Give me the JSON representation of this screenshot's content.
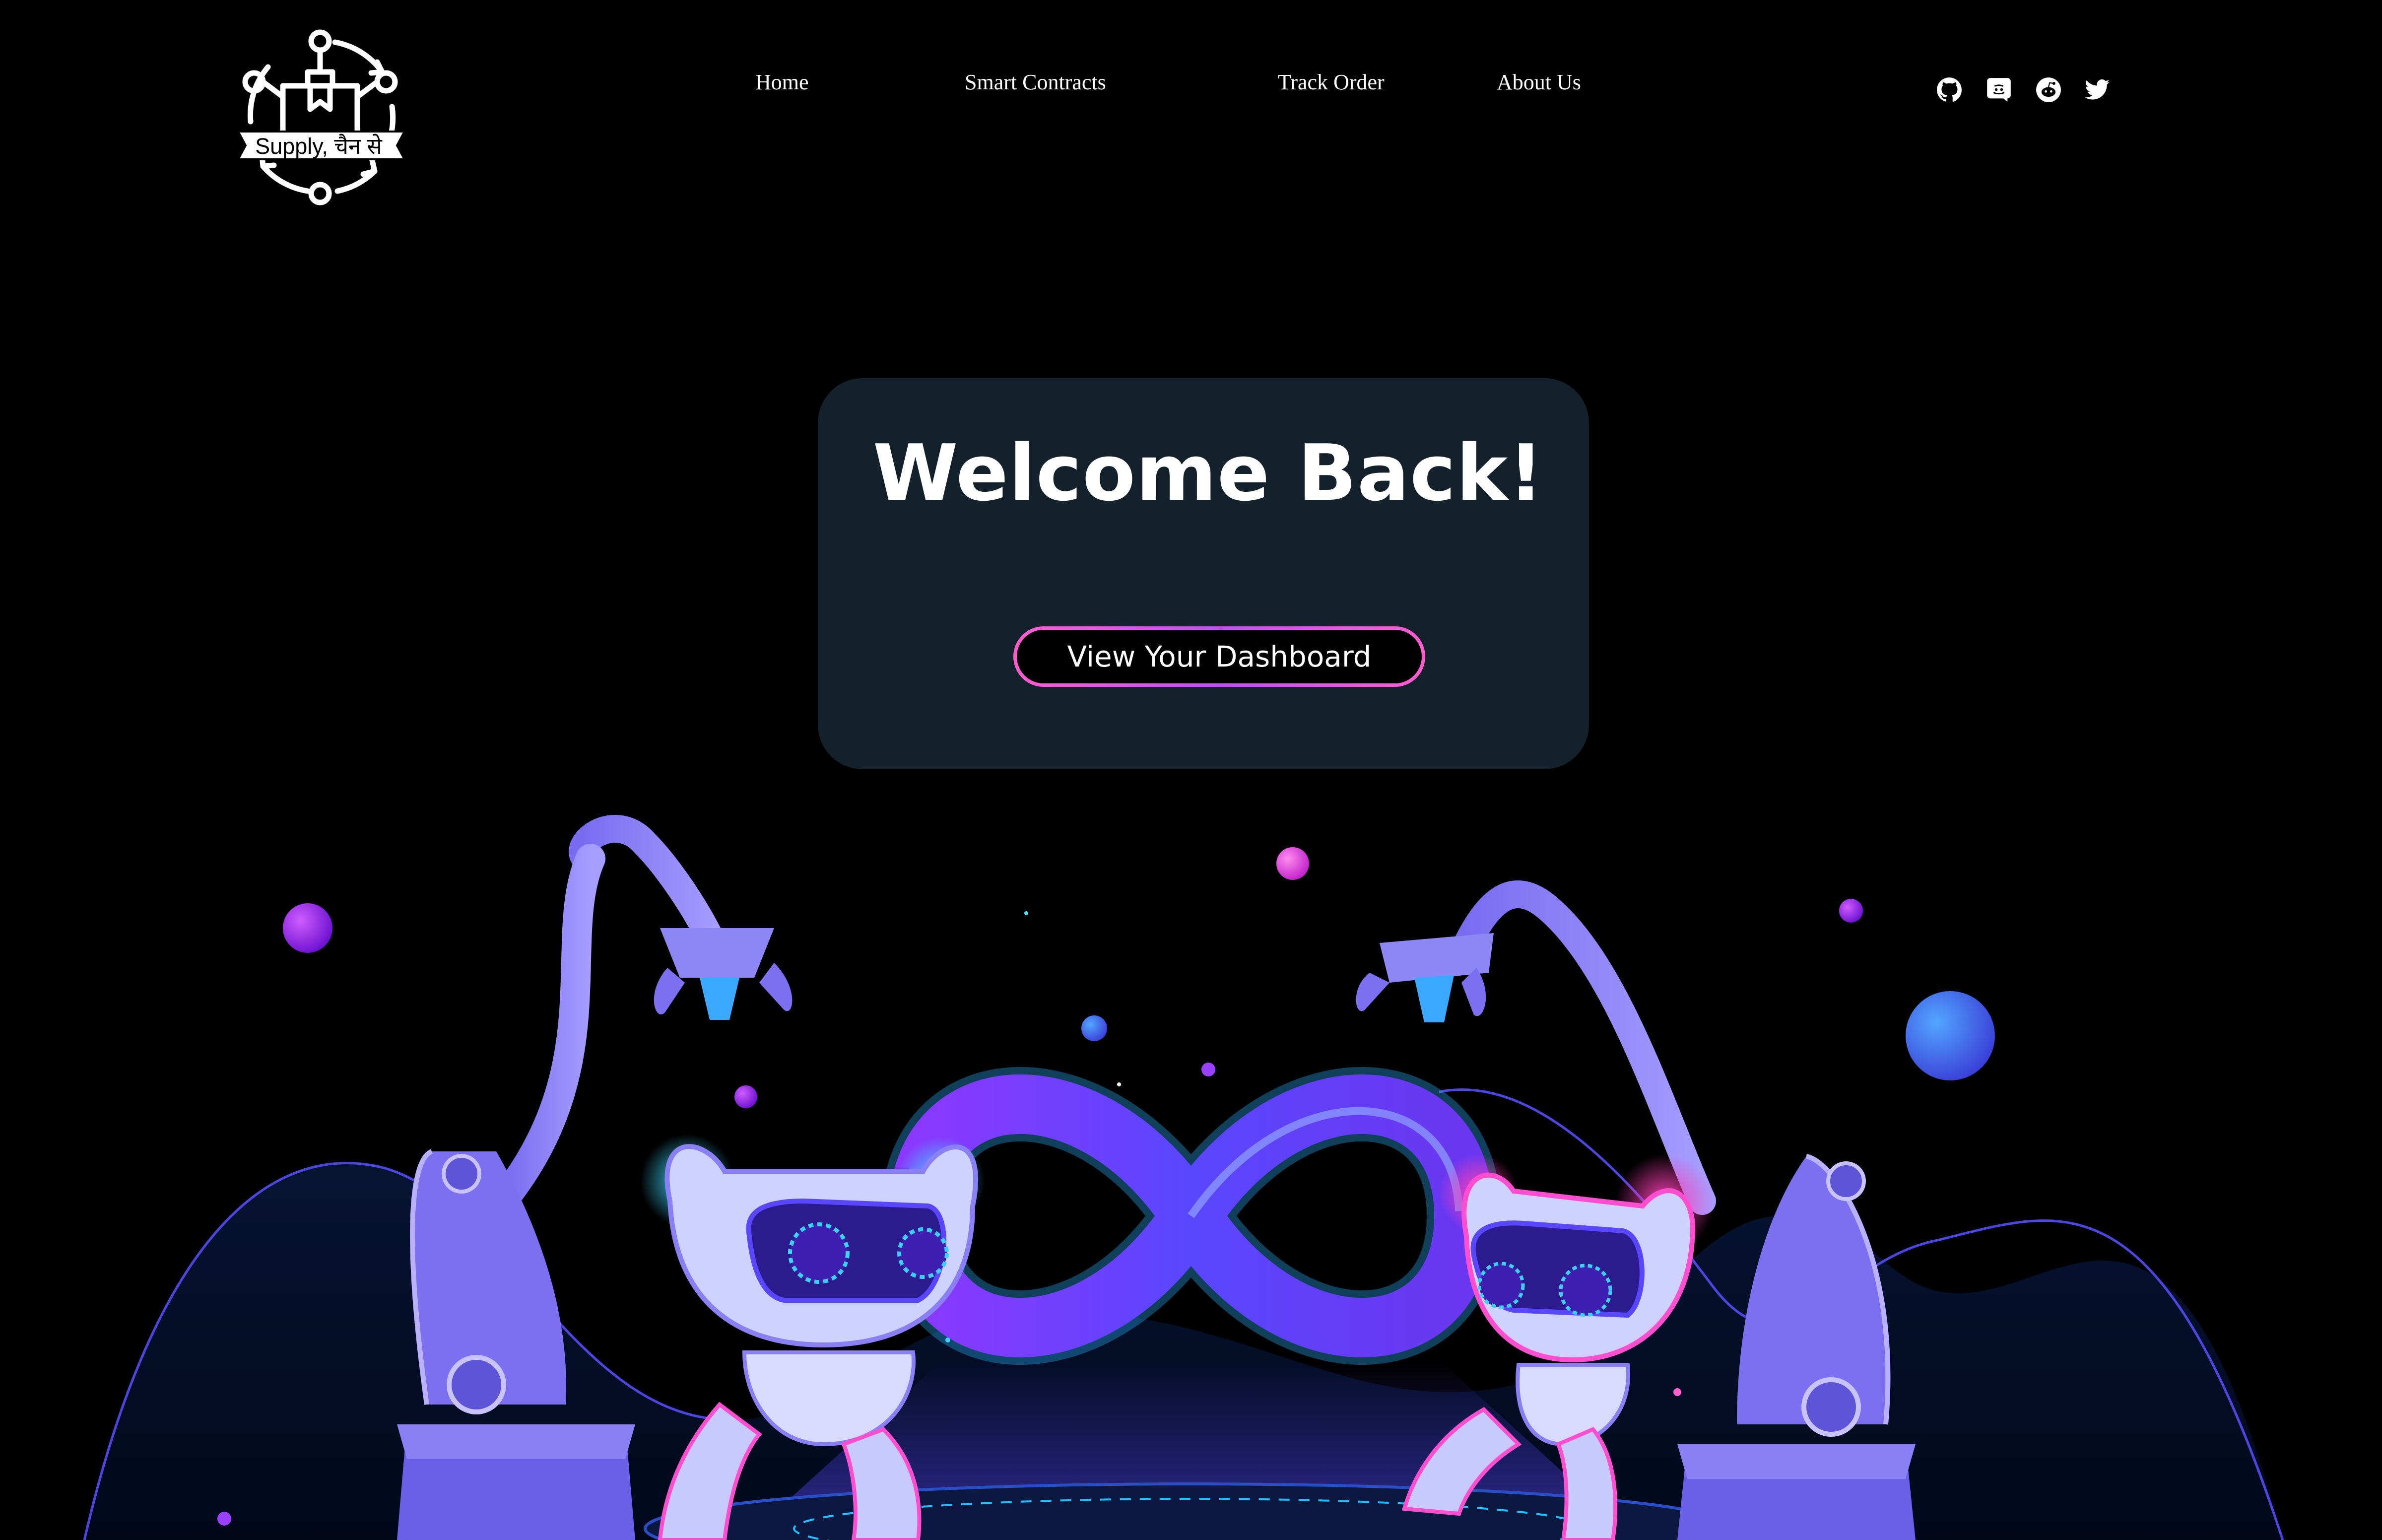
{
  "brand": {
    "logo_text": "Supply, चैन से"
  },
  "nav": {
    "items": [
      {
        "label": "Home"
      },
      {
        "label": "Smart Contracts"
      },
      {
        "label": "Track Order"
      },
      {
        "label": "About Us"
      }
    ]
  },
  "social": {
    "icons": [
      "github-icon",
      "discord-icon",
      "reddit-icon",
      "twitter-icon"
    ]
  },
  "welcome": {
    "title": "Welcome Back!",
    "button_label": "View Your Dashboard"
  },
  "colors": {
    "background": "#000000",
    "card": "#13212a",
    "button_border_pink": "#ff5ccd",
    "button_border_purple": "#c04cff",
    "accent_violet": "#6b3cf5"
  }
}
